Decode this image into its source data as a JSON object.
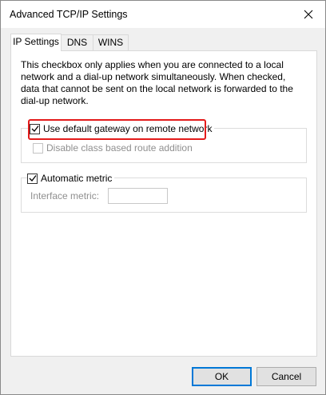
{
  "window": {
    "title": "Advanced TCP/IP Settings"
  },
  "tabs": [
    {
      "label": "IP Settings",
      "active": true
    },
    {
      "label": "DNS",
      "active": false
    },
    {
      "label": "WINS",
      "active": false
    }
  ],
  "description": "This checkbox only applies when you are connected to a local network and a dial-up network simultaneously.  When checked, data that cannot be sent on the local network is forwarded to the dial-up network.",
  "gateway_group": {
    "use_default_gateway": {
      "label": "Use default gateway on remote network",
      "checked": true,
      "highlighted_color": "#e31b1b"
    },
    "disable_class_route": {
      "label": "Disable class based route addition",
      "checked": false,
      "enabled": false
    }
  },
  "metric_group": {
    "automatic_metric": {
      "label": "Automatic metric",
      "checked": true
    },
    "interface_metric": {
      "label": "Interface metric:",
      "value": "",
      "enabled": false
    }
  },
  "buttons": {
    "ok": "OK",
    "cancel": "Cancel"
  },
  "colors": {
    "accent": "#0078d7",
    "highlight": "#e31b1b"
  },
  "icons": {
    "close": "close-icon",
    "check": "checkmark-icon"
  }
}
